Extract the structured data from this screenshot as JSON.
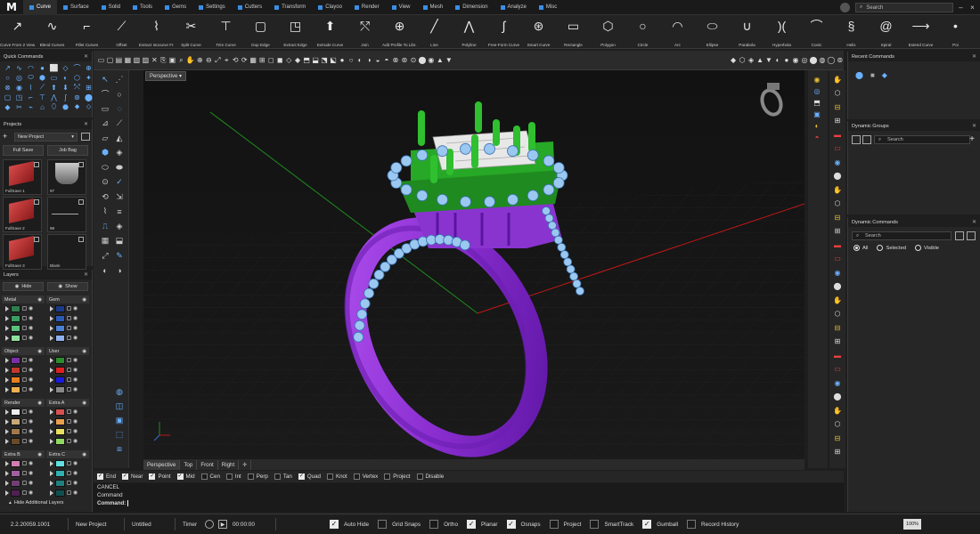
{
  "app": {
    "logo": "M"
  },
  "tabs": [
    {
      "label": "Curve",
      "active": true
    },
    {
      "label": "Surface"
    },
    {
      "label": "Solid"
    },
    {
      "label": "Tools"
    },
    {
      "label": "Gems"
    },
    {
      "label": "Settings"
    },
    {
      "label": "Cutters"
    },
    {
      "label": "Transform"
    },
    {
      "label": "Clayoo"
    },
    {
      "label": "Render"
    },
    {
      "label": "View"
    },
    {
      "label": "Mesh"
    },
    {
      "label": "Dimension"
    },
    {
      "label": "Analyze"
    },
    {
      "label": "Misc"
    }
  ],
  "search": {
    "placeholder": "Search"
  },
  "ribbon": [
    {
      "label": "Curve From 2 Views",
      "icon": "curve-from-2-views-icon",
      "glyph": "↗"
    },
    {
      "label": "Blend Curves",
      "icon": "blend-curves-icon",
      "glyph": "∿"
    },
    {
      "label": "Fillet Curves",
      "icon": "fillet-curves-icon",
      "glyph": "⌐"
    },
    {
      "label": "Offset",
      "icon": "offset-icon",
      "glyph": "⟋"
    },
    {
      "label": "Extract Isocurve Fr...",
      "icon": "extract-isocurve-icon",
      "glyph": "⌇"
    },
    {
      "label": "Split Curve",
      "icon": "split-curve-icon",
      "glyph": "✂"
    },
    {
      "label": "Trim Curve",
      "icon": "trim-curve-icon",
      "glyph": "⊤"
    },
    {
      "label": "Dup Edge",
      "icon": "dup-edge-icon",
      "glyph": "▢"
    },
    {
      "label": "Extract Edge",
      "icon": "extract-edge-icon",
      "glyph": "◳"
    },
    {
      "label": "Extrude Curve",
      "icon": "extrude-curve-icon",
      "glyph": "⬆"
    },
    {
      "label": "Join",
      "icon": "join-icon",
      "glyph": "⤲"
    },
    {
      "label": "Add Profile To Libr...",
      "icon": "add-profile-icon",
      "glyph": "⊕"
    },
    {
      "label": "Line",
      "icon": "line-icon",
      "glyph": "╱"
    },
    {
      "label": "Polyline",
      "icon": "polyline-icon",
      "glyph": "⋀"
    },
    {
      "label": "Free-Form Curve",
      "icon": "free-form-curve-icon",
      "glyph": "∫"
    },
    {
      "label": "Smart Curve",
      "icon": "smart-curve-icon",
      "glyph": "⊛"
    },
    {
      "label": "Rectangle",
      "icon": "rectangle-icon",
      "glyph": "▭"
    },
    {
      "label": "Polygon",
      "icon": "polygon-icon",
      "glyph": "⬡"
    },
    {
      "label": "Circle",
      "icon": "circle-icon",
      "glyph": "○"
    },
    {
      "label": "Arc",
      "icon": "arc-icon",
      "glyph": "◠"
    },
    {
      "label": "Ellipse",
      "icon": "ellipse-icon",
      "glyph": "⬭"
    },
    {
      "label": "Parabola",
      "icon": "parabola-icon",
      "glyph": "∪"
    },
    {
      "label": "Hyperbola",
      "icon": "hyperbola-icon",
      "glyph": ")("
    },
    {
      "label": "Conic",
      "icon": "conic-icon",
      "glyph": "⌒"
    },
    {
      "label": "Helix",
      "icon": "helix-icon",
      "glyph": "§"
    },
    {
      "label": "Spiral",
      "icon": "spiral-icon",
      "glyph": "@"
    },
    {
      "label": "Extend Curve",
      "icon": "extend-curve-icon",
      "glyph": "⟶"
    },
    {
      "label": "Poi",
      "icon": "point-icon",
      "glyph": "•"
    }
  ],
  "quick_commands": {
    "title": "Quick Commands"
  },
  "projects": {
    "title": "Projects",
    "dropdown": "New Project",
    "full_save": "Full Save",
    "job_bag": "Job Bag",
    "thumbs": [
      {
        "label": "FullSave 1"
      },
      {
        "label": "97"
      },
      {
        "label": "FullSave 2"
      },
      {
        "label": "98"
      },
      {
        "label": "FullSave 3"
      },
      {
        "label": "Blank"
      }
    ]
  },
  "layers": {
    "title": "Layers",
    "hide": "Hide",
    "show": "Show",
    "groups": [
      {
        "left": "Metal",
        "right": "Gem",
        "left_colors": [
          "#2e7d4f",
          "#3a9e63",
          "#5bc07d",
          "#8fe0a0"
        ],
        "right_colors": [
          "#1a3a8a",
          "#2a5ab8",
          "#4a7fd8",
          "#8fb0ee"
        ]
      },
      {
        "left": "Object",
        "right": "User",
        "left_colors": [
          "#7a2fa8",
          "#c0392b",
          "#e67e22",
          "#f0b050"
        ],
        "right_colors": [
          "#2e8b2e",
          "#e02020",
          "#1a1ae0",
          "#888888"
        ]
      },
      {
        "left": "Render",
        "right": "Extra A",
        "left_colors": [
          "#eeeeee",
          "#c8a878",
          "#a0784a",
          "#6a4a2a"
        ],
        "right_colors": [
          "#d85050",
          "#e8a050",
          "#e8e060",
          "#90d860"
        ]
      },
      {
        "left": "Extra B",
        "right": "Extra C",
        "left_colors": [
          "#d080b0",
          "#a060a0",
          "#704070",
          "#502050"
        ],
        "right_colors": [
          "#60e0e0",
          "#30b0b0",
          "#208080",
          "#105050"
        ]
      }
    ],
    "more": "Hide Additional Layers"
  },
  "viewport": {
    "label": "Perspective"
  },
  "viewport_tabs": [
    {
      "label": "Perspective",
      "active": true
    },
    {
      "label": "Top"
    },
    {
      "label": "Front"
    },
    {
      "label": "Right"
    }
  ],
  "recent_commands": {
    "title": "Recent Commands"
  },
  "dynamic_groups": {
    "title": "Dynamic Groups",
    "search": "Search"
  },
  "dynamic_commands": {
    "title": "Dynamic Commands",
    "search": "Search",
    "all": "All",
    "selected": "Selected",
    "visible": "Visible"
  },
  "osnaps": [
    {
      "label": "End",
      "on": true
    },
    {
      "label": "Near",
      "on": true
    },
    {
      "label": "Point",
      "on": true
    },
    {
      "label": "Mid",
      "on": true
    },
    {
      "label": "Cen",
      "on": false
    },
    {
      "label": "Int",
      "on": false
    },
    {
      "label": "Perp",
      "on": false
    },
    {
      "label": "Tan",
      "on": false
    },
    {
      "label": "Quad",
      "on": true
    },
    {
      "label": "Knot",
      "on": false
    },
    {
      "label": "Vertex",
      "on": false
    },
    {
      "label": "Project",
      "on": false
    },
    {
      "label": "Disable",
      "on": false
    }
  ],
  "command": {
    "line1": "CANCEL",
    "line2": "Command",
    "prompt": "Command:"
  },
  "status": {
    "version": "2.2.20059.1001",
    "new_project": "New Project",
    "untitled": "Untitled",
    "timer": "Timer",
    "time": "00:00:00",
    "zoom": "100%",
    "toggles": [
      {
        "label": "Auto Hide",
        "on": true
      },
      {
        "label": "Grid Snaps",
        "on": false
      },
      {
        "label": "Ortho",
        "on": false
      },
      {
        "label": "Planar",
        "on": true
      },
      {
        "label": "Osnaps",
        "on": true
      },
      {
        "label": "Project",
        "on": false
      },
      {
        "label": "SmartTrack",
        "on": false
      },
      {
        "label": "Gumball",
        "on": true
      },
      {
        "label": "Record History",
        "on": false
      }
    ]
  }
}
